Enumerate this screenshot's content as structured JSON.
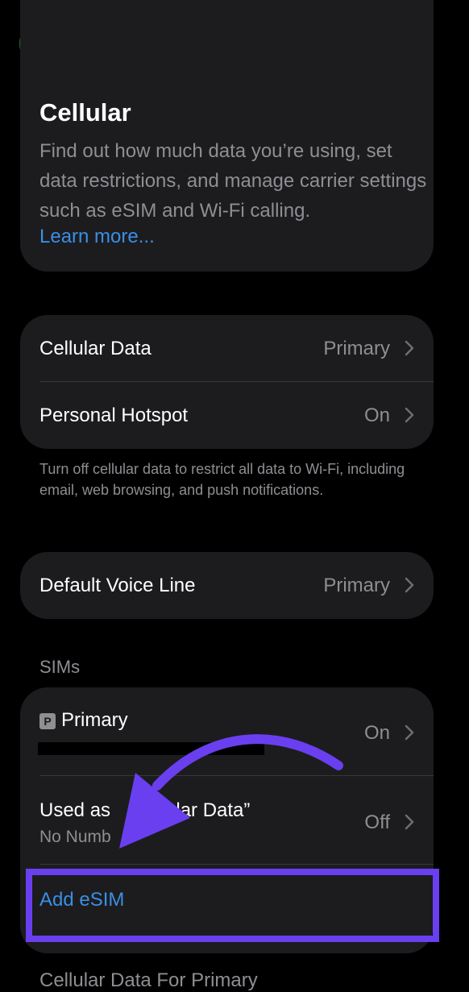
{
  "colors": {
    "background": "#000000",
    "card": "#1c1c1e",
    "link": "#3a8ee6",
    "secondary_text": "#8e8e93",
    "icon_green": "#2a9a3c",
    "annotation": "#6a3ff0"
  },
  "nav": {
    "back_icon": "chevron-left-icon"
  },
  "header_card": {
    "app_icon": "antenna-signal-icon",
    "title": "Cellular",
    "description": "Find out how much data you’re using, set data restrictions, and manage carrier settings such as eSIM and Wi-Fi calling.",
    "learn_more": "Learn more..."
  },
  "data_group": {
    "rows": [
      {
        "label": "Cellular Data",
        "value": "Primary"
      },
      {
        "label": "Personal Hotspot",
        "value": "On"
      }
    ],
    "footnote": "Turn off cellular data to restrict all data to Wi-Fi, including email, web browsing, and push notifications."
  },
  "voice_group": {
    "rows": [
      {
        "label": "Default Voice Line",
        "value": "Primary"
      }
    ]
  },
  "sims": {
    "header": "SIMs",
    "primary": {
      "badge": "P",
      "label": "Primary",
      "value": "On"
    },
    "secondary": {
      "label_a": "Used as",
      "label_b": "ellular Data”",
      "sublabel": "No Numb",
      "value": "Off"
    },
    "add_esim": "Add eSIM"
  },
  "next_section": {
    "header": "Cellular Data For Primary"
  }
}
